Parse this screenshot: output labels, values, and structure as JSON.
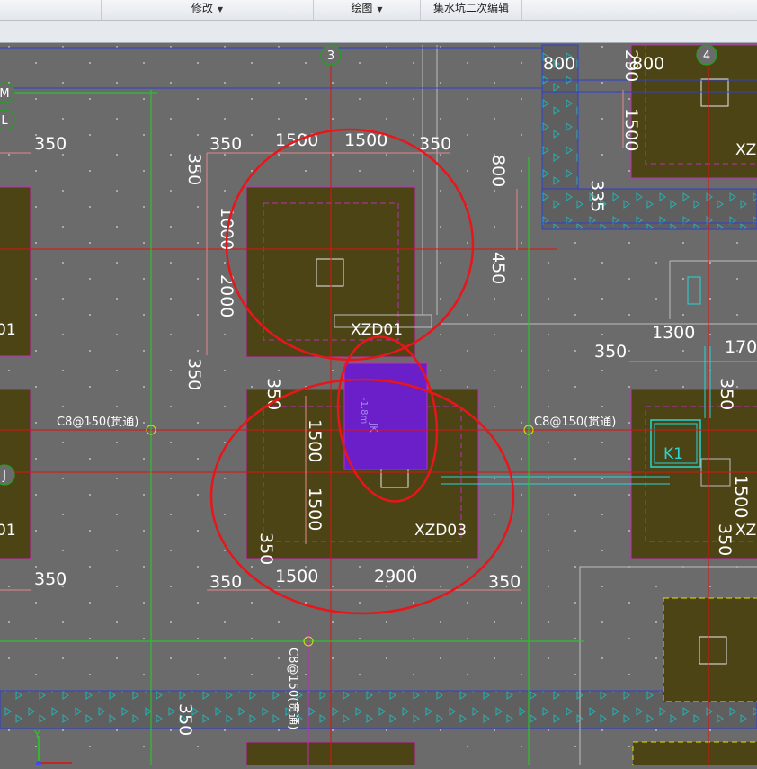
{
  "toolbar": {
    "modify_label": "修改",
    "draw_label": "绘图",
    "sump_edit_label": "集水坑二次编辑"
  },
  "grid": {
    "axis_3": "3",
    "axis_4": "4",
    "axis_M": "M",
    "axis_L": "L",
    "axis_J": "J"
  },
  "labels": {
    "xzd01": "XZD01",
    "xzd03": "XZD03",
    "xz_right_top": "XZ",
    "xz_right_mid": "XZ",
    "d01_top": "01",
    "d01_bottom": "01",
    "k1": "K1",
    "jk_name": "JK",
    "jk_depth": "-1.8m",
    "rebar_left": "C8@150(贯通)",
    "rebar_right": "C8@150(贯通)",
    "rebar_vertical": "C8@150(贯通)"
  },
  "dims": {
    "d350_a": "350",
    "d350_b": "350",
    "d1500_a": "1500",
    "d1500_b": "1500",
    "d350_c": "350",
    "d350_v1": "350",
    "d1000": "1000",
    "d2000": "2000",
    "d350_v2": "350",
    "d800_top": "800",
    "d800_v": "800",
    "d450": "450",
    "d1500_v_right": "1500",
    "d335": "335",
    "d350_d": "350",
    "d1500_v3": "1500",
    "d1500_v4": "1500",
    "d350_v5": "350",
    "d350_e": "350",
    "d1500_c": "1500",
    "d2900": "2900",
    "d350_f": "350",
    "d1300": "1300",
    "d350_g": "350",
    "d170": "170",
    "d350_v6": "350",
    "d1500_v7": "1500",
    "d350_v8": "350",
    "d350_bottom": "350",
    "d800_right_top": "800",
    "d290": "290"
  }
}
